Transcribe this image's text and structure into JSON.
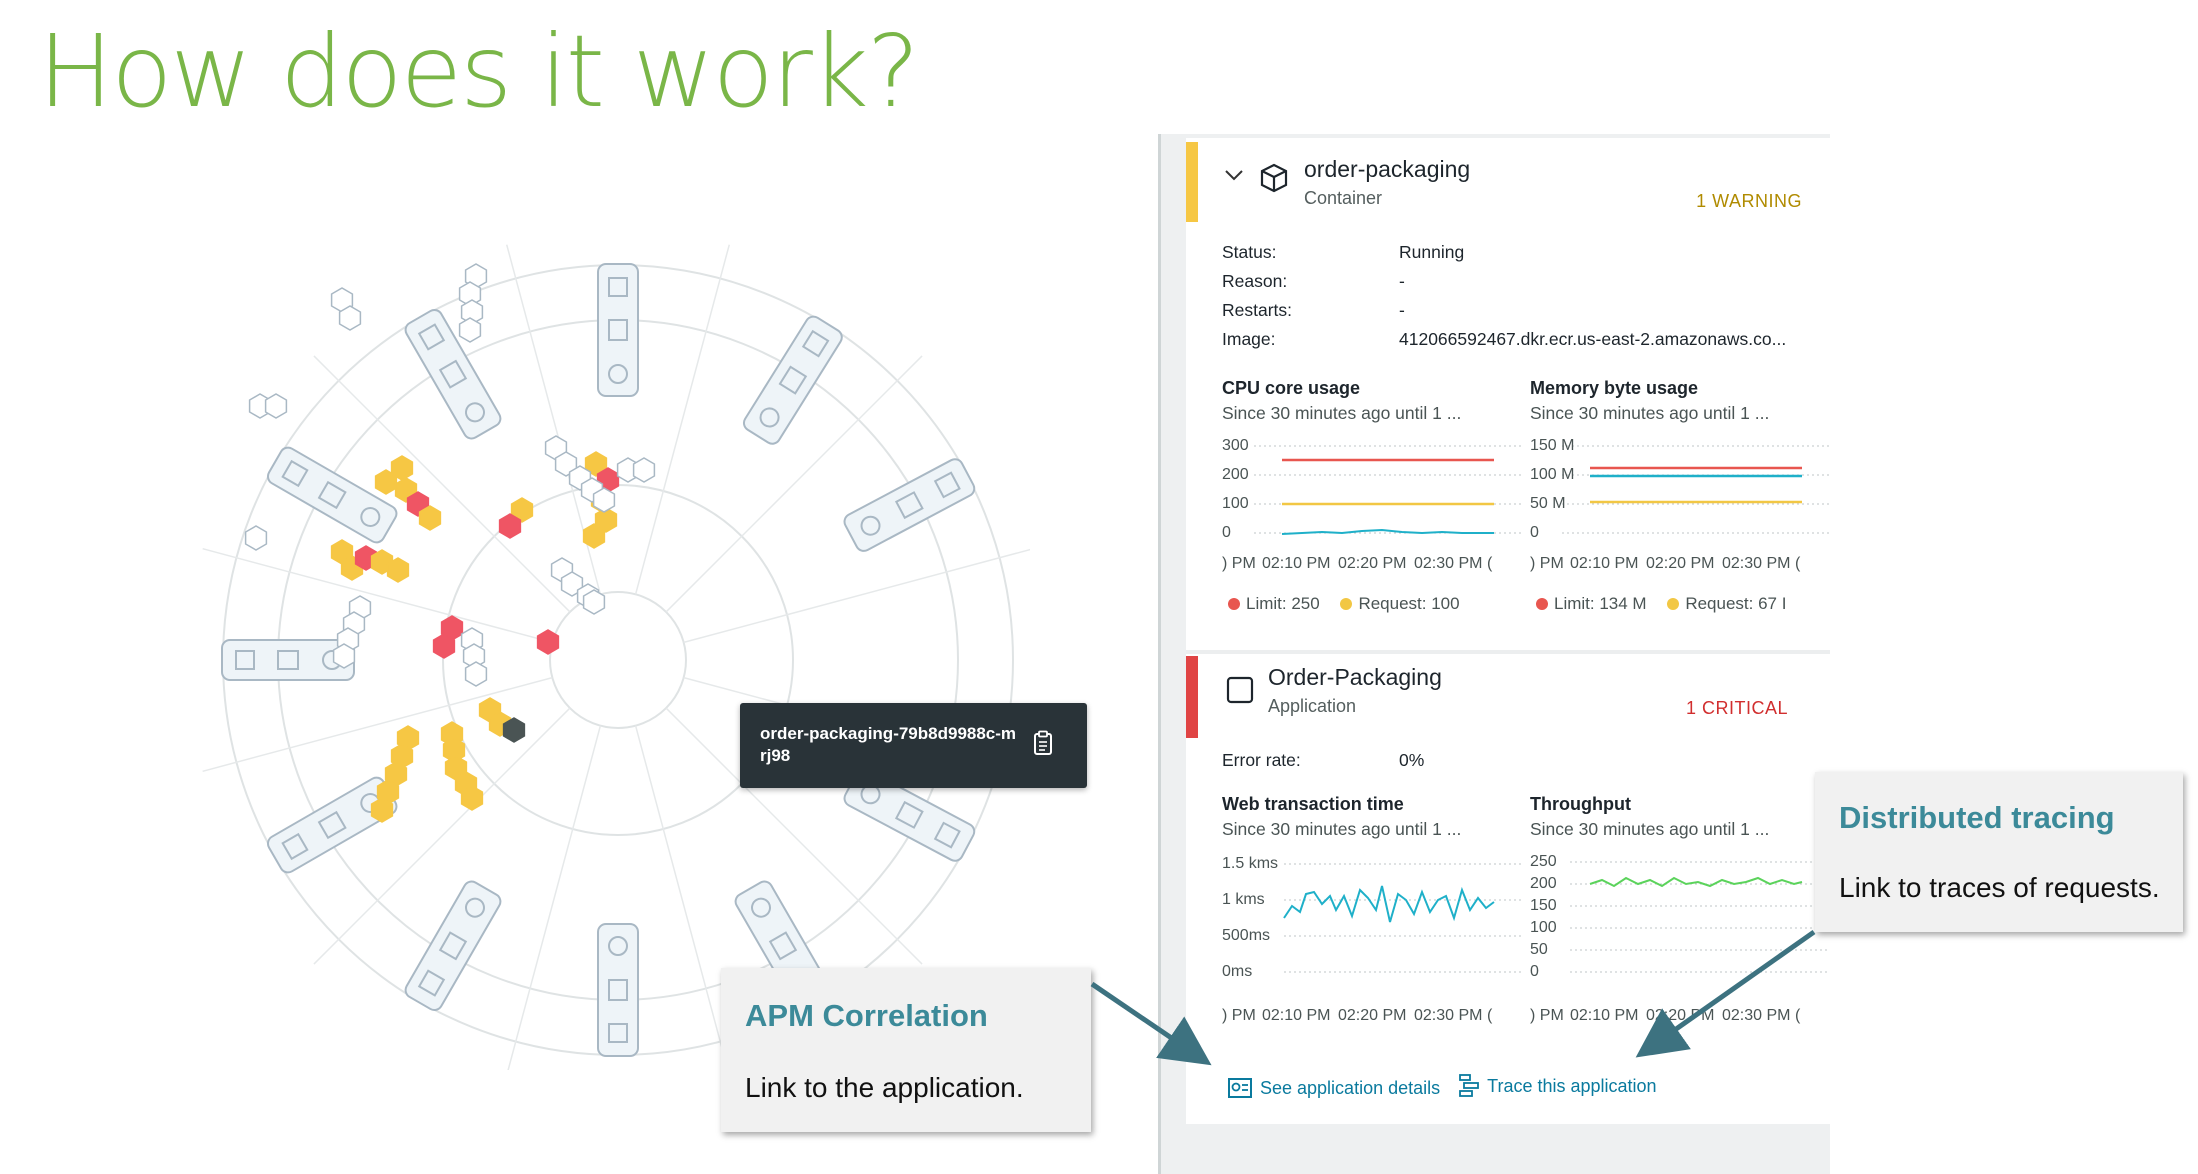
{
  "slide": {
    "title": "How does it work?"
  },
  "tooltip": {
    "pod_name": "order-packaging-79b8d9988c-mrj98",
    "copy_icon": "clipboard-icon"
  },
  "container_card": {
    "name": "order-packaging",
    "type": "Container",
    "badge": "1 WARNING",
    "status_color": "#f6c744",
    "fields": [
      {
        "key": "Status:",
        "value": "Running"
      },
      {
        "key": "Reason:",
        "value": "-"
      },
      {
        "key": "Restarts:",
        "value": "-"
      },
      {
        "key": "Image:",
        "value": "412066592467.dkr.ecr.us-east-2.amazonaws.co..."
      }
    ],
    "charts": [
      {
        "title": "CPU core usage",
        "subtitle": "Since 30 minutes ago until 1 ...",
        "yticks": [
          "300",
          "200",
          "100",
          "0"
        ],
        "xticks": [
          ") PM",
          "02:10 PM",
          "02:20 PM",
          "02:30 PM",
          "("
        ],
        "legend": [
          "Limit: 250",
          "Request: 100"
        ]
      },
      {
        "title": "Memory byte usage",
        "subtitle": "Since 30 minutes ago until 1 ...",
        "yticks": [
          "150 M",
          "100 M",
          "50 M",
          "0"
        ],
        "xticks": [
          ") PM",
          "02:10 PM",
          "02:20 PM",
          "02:30 PM",
          "("
        ],
        "legend": [
          "Limit: 134 M",
          "Request: 67 I"
        ]
      }
    ]
  },
  "app_card": {
    "name": "Order-Packaging",
    "type": "Application",
    "badge": "1 CRITICAL",
    "status_color": "#e04444",
    "error_rate": {
      "key": "Error rate:",
      "value": "0%"
    },
    "charts": [
      {
        "title": "Web transaction time",
        "subtitle": "Since 30 minutes ago until 1 ...",
        "yticks": [
          "1.5 kms",
          "1 kms",
          "500ms",
          "0ms"
        ],
        "xticks": [
          ") PM",
          "02:10 PM",
          "02:20 PM",
          "02:30 PM",
          "("
        ]
      },
      {
        "title": "Throughput",
        "subtitle": "Since 30 minutes ago until 1 ...",
        "yticks": [
          "250",
          "200",
          "150",
          "100",
          "50",
          "0"
        ],
        "xticks": [
          ") PM",
          "02:10 PM",
          "02:20 PM",
          "02:30 PM",
          "("
        ]
      }
    ],
    "links": {
      "details": "See application details",
      "trace": "Trace this application"
    }
  },
  "callouts": {
    "apm": {
      "title": "APM Correlation",
      "body": "Link to the application."
    },
    "tracing": {
      "title": "Distributed tracing",
      "body": "Link to traces of requests."
    }
  },
  "colors": {
    "title_green": "#7ab648",
    "limit": "#e8564f",
    "request": "#f2c744",
    "cpu_line": "#1fb0c9",
    "throughput_line": "#5bd35b",
    "link": "#0a7a9e",
    "callout_title": "#3c8a99"
  }
}
